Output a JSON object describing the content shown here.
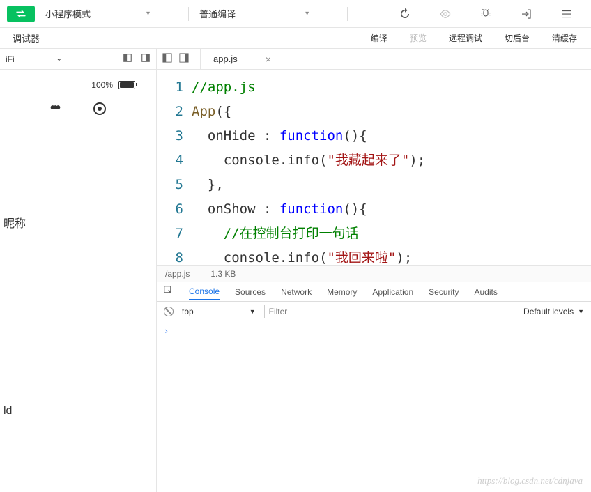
{
  "toolbar": {
    "mode_label": "小程序模式",
    "compile_type_label": "普通编译",
    "actions": {
      "compile": "编译",
      "preview": "预览",
      "remote_debug": "远程调试",
      "switch_bg": "切后台",
      "clear_cache": "清缓存"
    }
  },
  "debugger_label": "调试器",
  "wifi_label": "iFi",
  "battery_percent": "100%",
  "sidebar_text_1": "昵称",
  "sidebar_text_2": "ld",
  "editor": {
    "tab_name": "app.js",
    "file_path": "/app.js",
    "file_size": "1.3 KB",
    "lines": [
      "1",
      "2",
      "3",
      "4",
      "5",
      "6",
      "7",
      "8"
    ],
    "code": {
      "l1_comment": "//app.js",
      "l2_app": "App",
      "l2_rest": "({",
      "l3_key": "onHide",
      "l3_colon": " : ",
      "l3_func": "function",
      "l3_rest": "(){",
      "l4_pre": "console.info(",
      "l4_str": "\"我藏起来了\"",
      "l4_post": ");",
      "l5": "},",
      "l6_key": "onShow",
      "l6_colon": " : ",
      "l6_func": "function",
      "l6_rest": "(){",
      "l7_comment": "//在控制台打印一句话",
      "l8_pre": "console.info(",
      "l8_str": "\"我回来啦\"",
      "l8_post": ");"
    }
  },
  "devtools": {
    "tabs": {
      "console": "Console",
      "sources": "Sources",
      "network": "Network",
      "memory": "Memory",
      "application": "Application",
      "security": "Security",
      "audits": "Audits"
    },
    "context": "top",
    "filter_placeholder": "Filter",
    "levels": "Default levels",
    "prompt": "›"
  },
  "watermark": "https://blog.csdn.net/cdnjava"
}
